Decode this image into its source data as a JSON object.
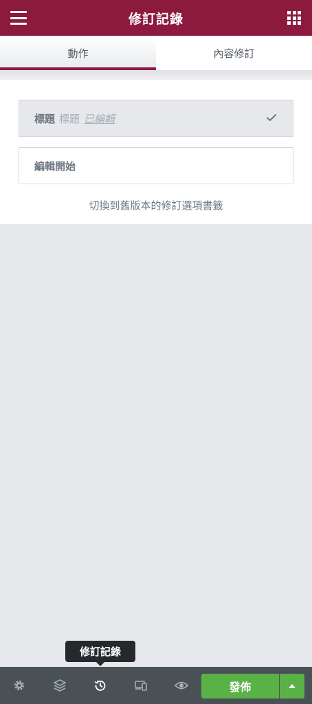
{
  "header": {
    "title": "修訂記錄",
    "menu_icon": "hamburger-icon",
    "apps_icon": "apps-grid-icon"
  },
  "tabs": [
    {
      "label": "動作",
      "active": true
    },
    {
      "label": "內容修訂",
      "active": false
    }
  ],
  "revisions": [
    {
      "label": "標題",
      "sub": "標題",
      "state": "已編輯",
      "current": true,
      "icon": "check-icon"
    },
    {
      "label": "編輯開始",
      "current": false
    }
  ],
  "hint": "切換到舊版本的修訂選項書籤",
  "tooltip": "修訂記錄",
  "footer": {
    "icons": [
      "gear-icon",
      "layers-icon",
      "history-icon",
      "responsive-icon",
      "eye-icon"
    ],
    "publish_label": "發佈"
  },
  "colors": {
    "brand": "#8c1a3f",
    "publish": "#5ab246",
    "footer_bg": "#495157",
    "panel_bg": "#e6e8ec"
  }
}
